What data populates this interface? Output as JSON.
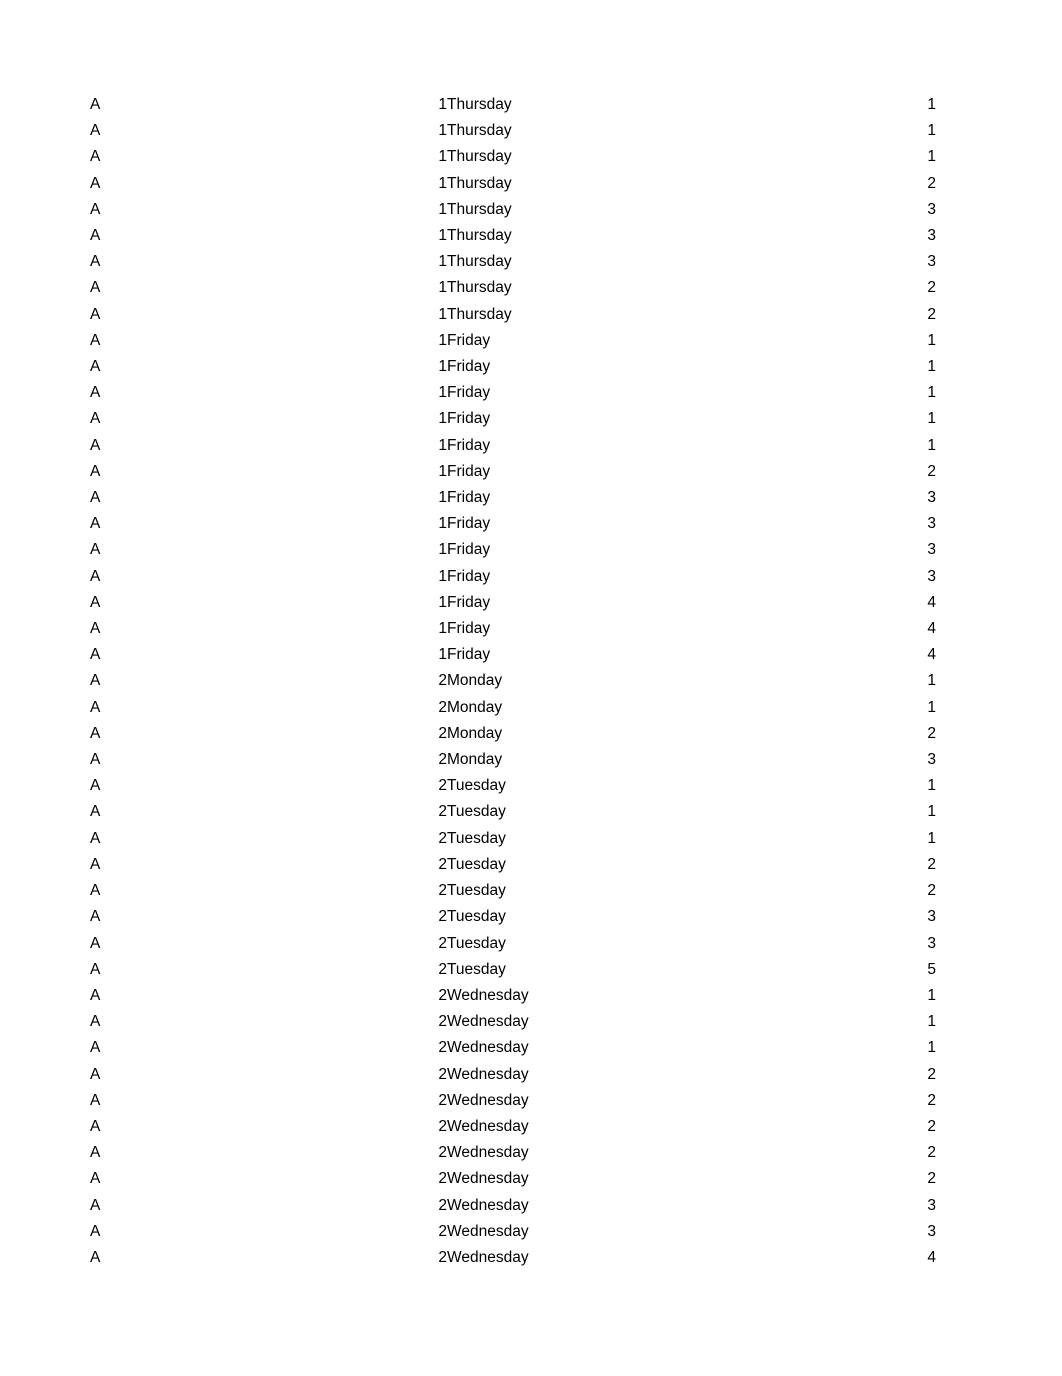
{
  "document": {
    "type": "tabular-listing",
    "page_background": "#ffffff",
    "text_color": "#000000",
    "row_count": 45,
    "columns": [
      {
        "key": "group",
        "align": "left"
      },
      {
        "key": "week",
        "align": "right"
      },
      {
        "key": "day",
        "align": "left"
      },
      {
        "key": "value",
        "align": "right"
      }
    ],
    "rows": [
      {
        "group": "A",
        "week": "1",
        "day": "Thursday",
        "value": "1"
      },
      {
        "group": "A",
        "week": "1",
        "day": "Thursday",
        "value": "1"
      },
      {
        "group": "A",
        "week": "1",
        "day": "Thursday",
        "value": "1"
      },
      {
        "group": "A",
        "week": "1",
        "day": "Thursday",
        "value": "2"
      },
      {
        "group": "A",
        "week": "1",
        "day": "Thursday",
        "value": "3"
      },
      {
        "group": "A",
        "week": "1",
        "day": "Thursday",
        "value": "3"
      },
      {
        "group": "A",
        "week": "1",
        "day": "Thursday",
        "value": "3"
      },
      {
        "group": "A",
        "week": "1",
        "day": "Thursday",
        "value": "2"
      },
      {
        "group": "A",
        "week": "1",
        "day": "Thursday",
        "value": "2"
      },
      {
        "group": "A",
        "week": "1",
        "day": "Friday",
        "value": "1"
      },
      {
        "group": "A",
        "week": "1",
        "day": "Friday",
        "value": "1"
      },
      {
        "group": "A",
        "week": "1",
        "day": "Friday",
        "value": "1"
      },
      {
        "group": "A",
        "week": "1",
        "day": "Friday",
        "value": "1"
      },
      {
        "group": "A",
        "week": "1",
        "day": "Friday",
        "value": "1"
      },
      {
        "group": "A",
        "week": "1",
        "day": "Friday",
        "value": "2"
      },
      {
        "group": "A",
        "week": "1",
        "day": "Friday",
        "value": "3"
      },
      {
        "group": "A",
        "week": "1",
        "day": "Friday",
        "value": "3"
      },
      {
        "group": "A",
        "week": "1",
        "day": "Friday",
        "value": "3"
      },
      {
        "group": "A",
        "week": "1",
        "day": "Friday",
        "value": "3"
      },
      {
        "group": "A",
        "week": "1",
        "day": "Friday",
        "value": "4"
      },
      {
        "group": "A",
        "week": "1",
        "day": "Friday",
        "value": "4"
      },
      {
        "group": "A",
        "week": "1",
        "day": "Friday",
        "value": "4"
      },
      {
        "group": "A",
        "week": "2",
        "day": "Monday",
        "value": "1"
      },
      {
        "group": "A",
        "week": "2",
        "day": "Monday",
        "value": "1"
      },
      {
        "group": "A",
        "week": "2",
        "day": "Monday",
        "value": "2"
      },
      {
        "group": "A",
        "week": "2",
        "day": "Monday",
        "value": "3"
      },
      {
        "group": "A",
        "week": "2",
        "day": "Tuesday",
        "value": "1"
      },
      {
        "group": "A",
        "week": "2",
        "day": "Tuesday",
        "value": "1"
      },
      {
        "group": "A",
        "week": "2",
        "day": "Tuesday",
        "value": "1"
      },
      {
        "group": "A",
        "week": "2",
        "day": "Tuesday",
        "value": "2"
      },
      {
        "group": "A",
        "week": "2",
        "day": "Tuesday",
        "value": "2"
      },
      {
        "group": "A",
        "week": "2",
        "day": "Tuesday",
        "value": "3"
      },
      {
        "group": "A",
        "week": "2",
        "day": "Tuesday",
        "value": "3"
      },
      {
        "group": "A",
        "week": "2",
        "day": "Tuesday",
        "value": "5"
      },
      {
        "group": "A",
        "week": "2",
        "day": "Wednesday",
        "value": "1"
      },
      {
        "group": "A",
        "week": "2",
        "day": "Wednesday",
        "value": "1"
      },
      {
        "group": "A",
        "week": "2",
        "day": "Wednesday",
        "value": "1"
      },
      {
        "group": "A",
        "week": "2",
        "day": "Wednesday",
        "value": "2"
      },
      {
        "group": "A",
        "week": "2",
        "day": "Wednesday",
        "value": "2"
      },
      {
        "group": "A",
        "week": "2",
        "day": "Wednesday",
        "value": "2"
      },
      {
        "group": "A",
        "week": "2",
        "day": "Wednesday",
        "value": "2"
      },
      {
        "group": "A",
        "week": "2",
        "day": "Wednesday",
        "value": "2"
      },
      {
        "group": "A",
        "week": "2",
        "day": "Wednesday",
        "value": "3"
      },
      {
        "group": "A",
        "week": "2",
        "day": "Wednesday",
        "value": "3"
      },
      {
        "group": "A",
        "week": "2",
        "day": "Wednesday",
        "value": "4"
      }
    ]
  }
}
